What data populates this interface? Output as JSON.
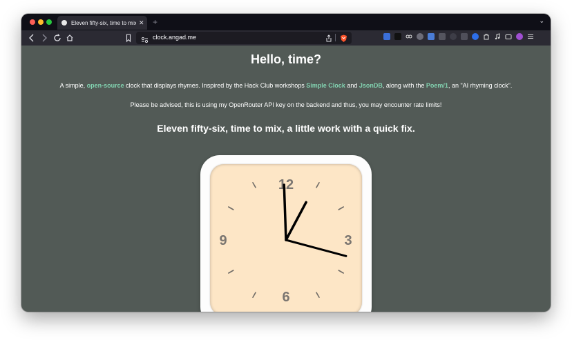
{
  "browser": {
    "tab_title": "Eleven fifty-six, time to mix, a little work with a quick fix.",
    "close_glyph": "✕",
    "new_tab_glyph": "+",
    "tabs_menu_glyph": "⌄",
    "url": "clock.angad.me",
    "colors": {
      "tabbar": "#0f0f17",
      "toolbar": "#2b2a33",
      "urlbar": "#1c1b22"
    }
  },
  "page": {
    "heading": "Hello, time?",
    "description": {
      "p1": "A simple, ",
      "link_open_source": "open-source",
      "p2": " clock that displays rhymes. Inspired by the Hack Club workshops ",
      "link_simple_clock": "Simple Clock",
      "p3": " and ",
      "link_jsondb": "JsonDB",
      "p4": ", along with the ",
      "link_poem": "Poem/1",
      "p5": ", an \"AI rhyming clock\"."
    },
    "notice": "Please be advised, this is using my OpenRouter API key on the backend and thus, you may encounter rate limits!",
    "rhyme": "Eleven fifty-six, time to mix, a little work with a quick fix.",
    "colors": {
      "background": "#525a56",
      "link": "#82d2b0",
      "clock_face": "#fde6c6"
    }
  },
  "clock": {
    "numerals": [
      "12",
      "3",
      "6",
      "9"
    ],
    "time": {
      "hour": 11,
      "minute": 56
    }
  }
}
